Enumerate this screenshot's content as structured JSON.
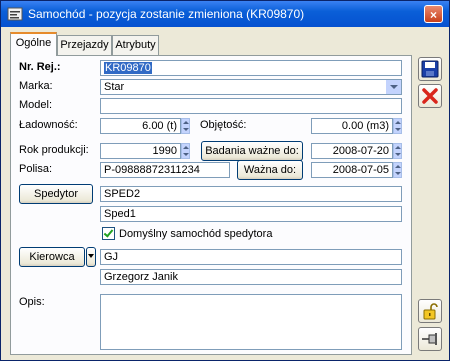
{
  "window": {
    "title": "Samochód - pozycja zostanie zmieniona  (KR09870)",
    "close": "×"
  },
  "tabs": [
    {
      "label": "Ogólne",
      "active": true
    },
    {
      "label": "Przejazdy",
      "active": false
    },
    {
      "label": "Atrybuty",
      "active": false
    }
  ],
  "form": {
    "nr_rej_label": "Nr. Rej.:",
    "nr_rej_value": "KR09870",
    "marka_label": "Marka:",
    "marka_value": "Star",
    "model_label": "Model:",
    "model_value": "",
    "ladownosc_label": "Ładowność:",
    "ladownosc_value": "6.00 (t)",
    "objetosc_label": "Objętość:",
    "objetosc_value": "0.00 (m3)",
    "rok_label": "Rok produkcji:",
    "rok_value": "1990",
    "badania_button": "Badania ważne do:",
    "badania_value": "2008-07-20",
    "polisa_label": "Polisa:",
    "polisa_value": "P-09888872311234",
    "wazna_button": "Ważna do:",
    "wazna_value": "2008-07-05",
    "spedytor_button": "Spedytor",
    "spedytor_code": "SPED2",
    "spedytor_name": "Sped1",
    "domyslny_label": "Domyślny samochód spedytora",
    "domyslny_checked": true,
    "kierowca_button": "Kierowca",
    "kierowca_code": "GJ",
    "kierowca_name": "Grzegorz Janik",
    "opis_label": "Opis:",
    "opis_value": ""
  },
  "side_buttons": {
    "save": "save-icon",
    "cancel": "cancel-icon",
    "lock": "padlock-icon",
    "pin": "pin-icon"
  },
  "colors": {
    "titlebar": "#0a5fd8",
    "selection": "#316ac5",
    "tab_accent": "#e68b2c",
    "cancel": "#d9261c"
  }
}
